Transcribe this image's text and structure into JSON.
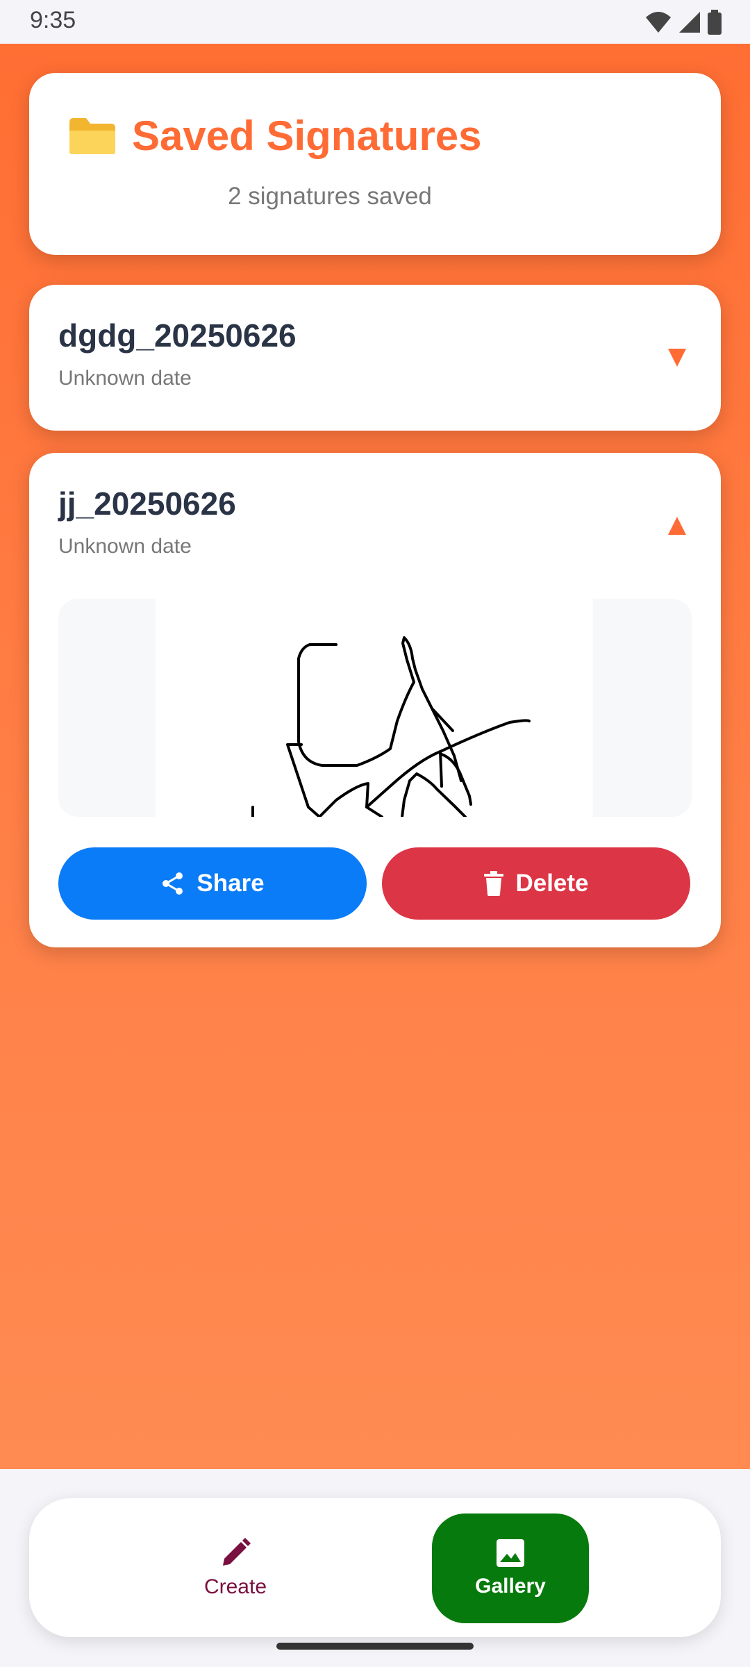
{
  "status_bar": {
    "time": "9:35"
  },
  "header": {
    "icon": "folder-icon",
    "title": "Saved Signatures",
    "subtitle": "2 signatures saved"
  },
  "signatures": [
    {
      "name": "dgdg_20250626",
      "date": "Unknown date",
      "expanded": false
    },
    {
      "name": "jj_20250626",
      "date": "Unknown date",
      "expanded": true,
      "actions": {
        "share_label": "Share",
        "delete_label": "Delete"
      }
    }
  ],
  "bottom_nav": {
    "items": [
      {
        "label": "Create",
        "icon": "pencil-icon",
        "active": false
      },
      {
        "label": "Gallery",
        "icon": "image-icon",
        "active": true
      }
    ]
  },
  "colors": {
    "accent": "#ff6b35",
    "share": "#0a7cf7",
    "delete": "#dc3545",
    "nav_active": "#067a0c",
    "nav_inactive_text": "#7a1040"
  }
}
